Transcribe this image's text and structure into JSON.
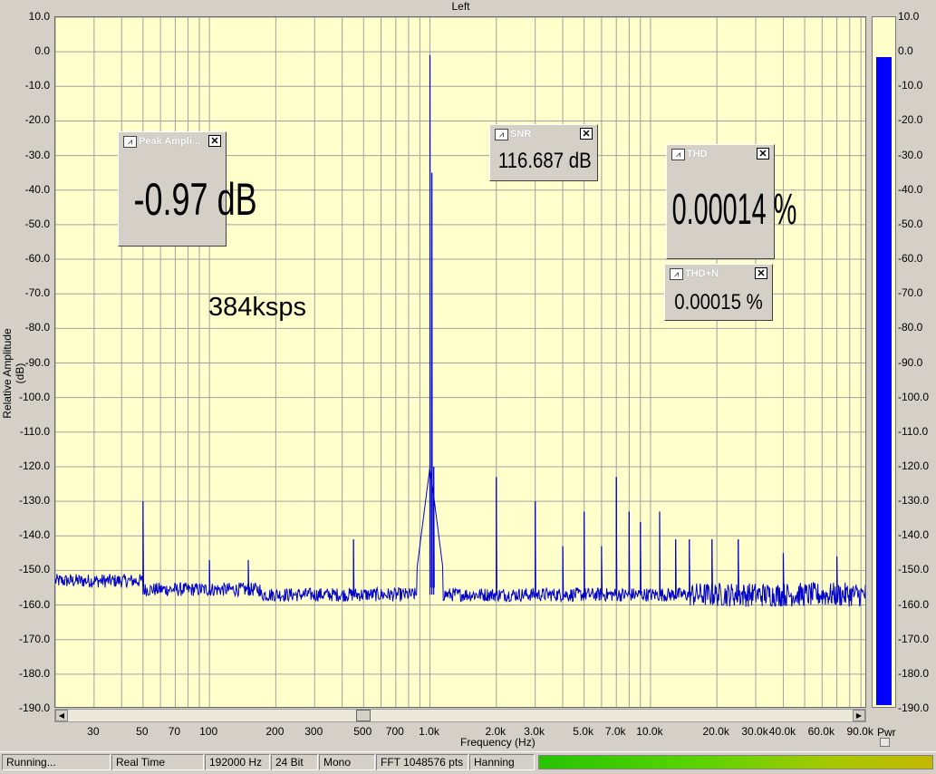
{
  "window": {
    "channel_title": "Left"
  },
  "plot": {
    "ylabel": "Relative Amplitude (dB)",
    "xlabel": "Frequency (Hz)",
    "yticks": [
      "10.0",
      "0.0",
      "-10.0",
      "-20.0",
      "-30.0",
      "-40.0",
      "-50.0",
      "-60.0",
      "-70.0",
      "-80.0",
      "-90.0",
      "-100.0",
      "-110.0",
      "-120.0",
      "-130.0",
      "-140.0",
      "-150.0",
      "-160.0",
      "-170.0",
      "-180.0",
      "-190.0"
    ],
    "xticks": [
      "30",
      "50",
      "70",
      "100",
      "200",
      "300",
      "500",
      "700",
      "1.0k",
      "2.0k",
      "3.0k",
      "5.0k",
      "7.0k",
      "10.0k",
      "20.0k",
      "30.0k",
      "40.0k",
      "60.0k",
      "90.0k"
    ],
    "annotation": "384ksps"
  },
  "widgets": {
    "peak": {
      "title": "Peak Ampli...",
      "value": "-0.97 dB",
      "icon": "waveform-icon"
    },
    "snr": {
      "title": "SNR",
      "value": "116.687 dB",
      "icon": "waveform-icon"
    },
    "thd": {
      "title": "THD",
      "value": "0.00014 %",
      "icon": "waveform-icon"
    },
    "thdn": {
      "title": "THD+N",
      "value": "0.00015 %",
      "icon": "waveform-icon"
    }
  },
  "meter": {
    "label": "Pwr",
    "level_db": -0.97,
    "ticks": [
      "10.0",
      "0.0",
      "-10.0",
      "-20.0",
      "-30.0",
      "-40.0",
      "-50.0",
      "-60.0",
      "-70.0",
      "-80.0",
      "-90.0",
      "-100.0",
      "-110.0",
      "-120.0",
      "-130.0",
      "-140.0",
      "-150.0",
      "-160.0",
      "-170.0",
      "-180.0",
      "-190.0"
    ]
  },
  "statusbar": {
    "state": "Running...",
    "mode": "Real Time",
    "rate": "192000 Hz",
    "bits": "24 Bit",
    "channels": "Mono",
    "fft": "FFT 1048576 pts",
    "window": "Hanning"
  },
  "colors": {
    "plot_bg": "#ffffcc",
    "trace": "#0000cc",
    "meter_fill": "#0000ff"
  },
  "chart_data": {
    "type": "line",
    "title": "Left",
    "xlabel": "Frequency (Hz)",
    "ylabel": "Relative Amplitude (dB)",
    "xscale": "log",
    "xlim": [
      20,
      96000
    ],
    "ylim": [
      -190,
      10
    ],
    "grid": true,
    "noise_floor_db": -157,
    "peaks": [
      {
        "x": 50,
        "y": -130
      },
      {
        "x": 100,
        "y": -147
      },
      {
        "x": 150,
        "y": -147
      },
      {
        "x": 450,
        "y": -141
      },
      {
        "x": 1000,
        "y": -1
      },
      {
        "x": 1020,
        "y": -35
      },
      {
        "x": 1040,
        "y": -120
      },
      {
        "x": 2000,
        "y": -123
      },
      {
        "x": 3000,
        "y": -130
      },
      {
        "x": 4000,
        "y": -143
      },
      {
        "x": 5000,
        "y": -133
      },
      {
        "x": 6000,
        "y": -143
      },
      {
        "x": 7000,
        "y": -123
      },
      {
        "x": 8000,
        "y": -133
      },
      {
        "x": 9000,
        "y": -136
      },
      {
        "x": 11000,
        "y": -133
      },
      {
        "x": 13000,
        "y": -141
      },
      {
        "x": 15000,
        "y": -141
      },
      {
        "x": 19000,
        "y": -141
      },
      {
        "x": 25000,
        "y": -141
      },
      {
        "x": 40000,
        "y": -145
      },
      {
        "x": 70000,
        "y": -146
      }
    ]
  }
}
